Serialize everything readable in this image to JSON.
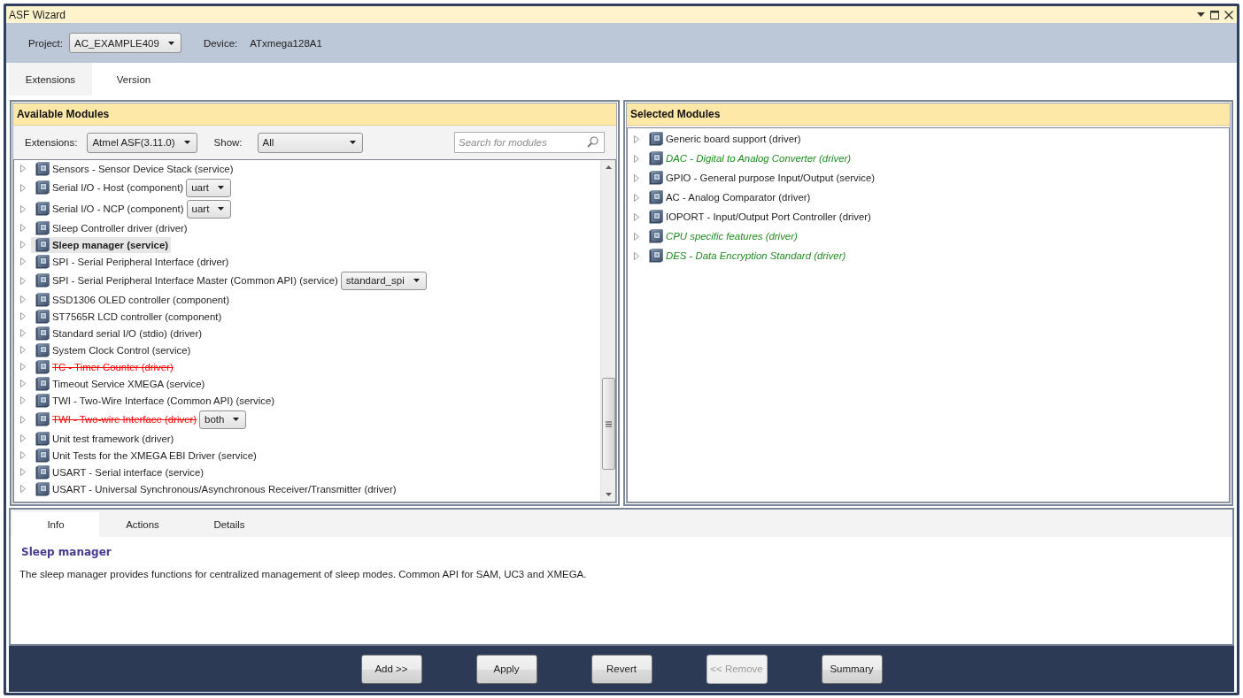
{
  "window": {
    "title": "ASF Wizard"
  },
  "header": {
    "project_label": "Project:",
    "project": "AC_EXAMPLE409",
    "device_label": "Device:",
    "device": "ATxmega128A1"
  },
  "tabs": [
    {
      "label": "Extensions",
      "selected": true
    },
    {
      "label": "Version",
      "selected": false
    }
  ],
  "available_modules": {
    "title": "Available Modules",
    "extensions_label": "Extensions:",
    "extensions": "Atmel ASF(3.11.0)",
    "show_label": "Show:",
    "show": "All",
    "search": {
      "placeholder": "Search for modules"
    },
    "items": [
      {
        "label": "Sensors - Sensor Device Stack (service)",
        "selected": false,
        "struck_out": false
      },
      {
        "label": "Serial I/O - Host (component)",
        "selected": false,
        "struck_out": false,
        "option": "uart"
      },
      {
        "label": "Serial I/O - NCP (component)",
        "selected": false,
        "struck_out": false,
        "option": "uart"
      },
      {
        "label": "Sleep Controller driver (driver)",
        "selected": false,
        "struck_out": false
      },
      {
        "label": "Sleep manager (service)",
        "selected": true,
        "struck_out": false
      },
      {
        "label": "SPI - Serial Peripheral Interface (driver)",
        "selected": false,
        "struck_out": false
      },
      {
        "label": "SPI - Serial Peripheral Interface Master (Common API) (service)",
        "selected": false,
        "struck_out": false,
        "option": "standard_spi"
      },
      {
        "label": "SSD1306 OLED controller (component)",
        "selected": false,
        "struck_out": false
      },
      {
        "label": "ST7565R LCD controller (component)",
        "selected": false,
        "struck_out": false
      },
      {
        "label": "Standard serial I/O (stdio) (driver)",
        "selected": false,
        "struck_out": false
      },
      {
        "label": "System Clock Control (service)",
        "selected": false,
        "struck_out": false
      },
      {
        "label": "TC - Timer Counter (driver)",
        "selected": false,
        "struck_out": true
      },
      {
        "label": "Timeout Service XMEGA (service)",
        "selected": false,
        "struck_out": false
      },
      {
        "label": "TWI - Two-Wire Interface (Common API) (service)",
        "selected": false,
        "struck_out": false
      },
      {
        "label": "TWI - Two-wire Interface (driver)",
        "selected": false,
        "struck_out": true,
        "option": "both"
      },
      {
        "label": "Unit test framework (driver)",
        "selected": false,
        "struck_out": false
      },
      {
        "label": "Unit Tests for the XMEGA EBI Driver (service)",
        "selected": false,
        "struck_out": false
      },
      {
        "label": "USART - Serial interface (service)",
        "selected": false,
        "struck_out": false
      },
      {
        "label": "USART - Universal Synchronous/Asynchronous Receiver/Transmitter (driver)",
        "selected": false,
        "struck_out": false
      }
    ]
  },
  "selected_modules": {
    "title": "Selected Modules",
    "items": [
      {
        "label": "Generic board support (driver)",
        "dependency": false
      },
      {
        "label": "DAC - Digital to Analog Converter (driver)",
        "dependency": true
      },
      {
        "label": "GPIO - General purpose Input/Output (service)",
        "dependency": false
      },
      {
        "label": "AC - Analog Comparator (driver)",
        "dependency": false
      },
      {
        "label": "IOPORT - Input/Output Port Controller (driver)",
        "dependency": false
      },
      {
        "label": "CPU specific features (driver)",
        "dependency": true
      },
      {
        "label": "DES - Data Encryption Standard (driver)",
        "dependency": true
      }
    ]
  },
  "info_tabs": [
    {
      "label": "Info",
      "selected": true
    },
    {
      "label": "Actions",
      "selected": false
    },
    {
      "label": "Details",
      "selected": false
    }
  ],
  "info": {
    "title": "Sleep manager",
    "description": "The sleep manager provides functions for centralized management of sleep modes. Common API for SAM, UC3 and XMEGA."
  },
  "buttons": [
    {
      "label": "Add >>",
      "disabled": false
    },
    {
      "label": "Apply",
      "disabled": false
    },
    {
      "label": "Revert",
      "disabled": false
    },
    {
      "label": "<< Remove",
      "disabled": true
    },
    {
      "label": "Summary",
      "disabled": false
    }
  ]
}
